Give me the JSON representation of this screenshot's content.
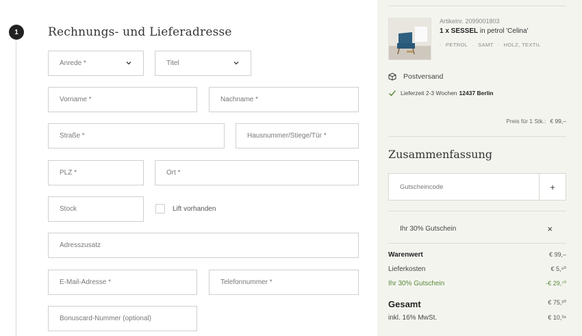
{
  "step": {
    "number": "1",
    "title": "Rechnungs- und Lieferadresse"
  },
  "form": {
    "anrede": "Anrede *",
    "titel": "Titel",
    "vorname": "Vorname *",
    "nachname": "Nachname *",
    "strasse": "Straße *",
    "hausnummer": "Hausnummer/Stiege/Tür *",
    "plz": "PLZ *",
    "ort": "Ort *",
    "stock": "Stock",
    "lift_label": "Lift vorhanden",
    "adresszusatz": "Adresszusatz",
    "email": "E-Mail-Adresse *",
    "telefon": "Telefonnummer *",
    "bonuscard": "Bonuscard-Nummer (optional)"
  },
  "cart": {
    "article_nr": "Artikelnr. 2099001803",
    "qty_name": "1 x SESSEL",
    "variant": "in petrol 'Celina'",
    "attributes": [
      "PETROL",
      "SAMT",
      "HOLZ, TEXTIL"
    ],
    "shipping_method": "Postversand",
    "delivery_text": "Lieferzeit 2-3 Wochen",
    "delivery_location": "12437 Berlin",
    "unit_price_label": "Preis für 1 Stk.:",
    "unit_price": "€ 99,–"
  },
  "summary": {
    "title": "Zusammenfassung",
    "voucher_placeholder": "Gutscheincode",
    "voucher_add": "+",
    "coupon_applied": "Ihr 30% Gutschein",
    "coupon_remove": "×",
    "rows": {
      "warenwert": {
        "label": "Warenwert",
        "value": "€ 99,–"
      },
      "lieferkosten": {
        "label": "Lieferkosten",
        "value": "€ 5,⁹⁰"
      },
      "gutschein": {
        "label": "Ihr 30% Gutschein",
        "value": "-€ 29,⁷⁰"
      },
      "gesamt": {
        "label": "Gesamt",
        "value": "€ 75,²⁰"
      },
      "mwst": {
        "label": "inkl. 16% MwSt.",
        "value": "€ 10,³⁸"
      }
    }
  },
  "colors": {
    "accent_green": "#5a8a3a",
    "panel_bg": "#f4f4ef",
    "step_badge": "#222222"
  },
  "icons": {
    "chevron": "chevron-down-icon",
    "package": "package-icon",
    "check": "check-icon",
    "close": "close-icon",
    "plus": "plus-icon"
  }
}
